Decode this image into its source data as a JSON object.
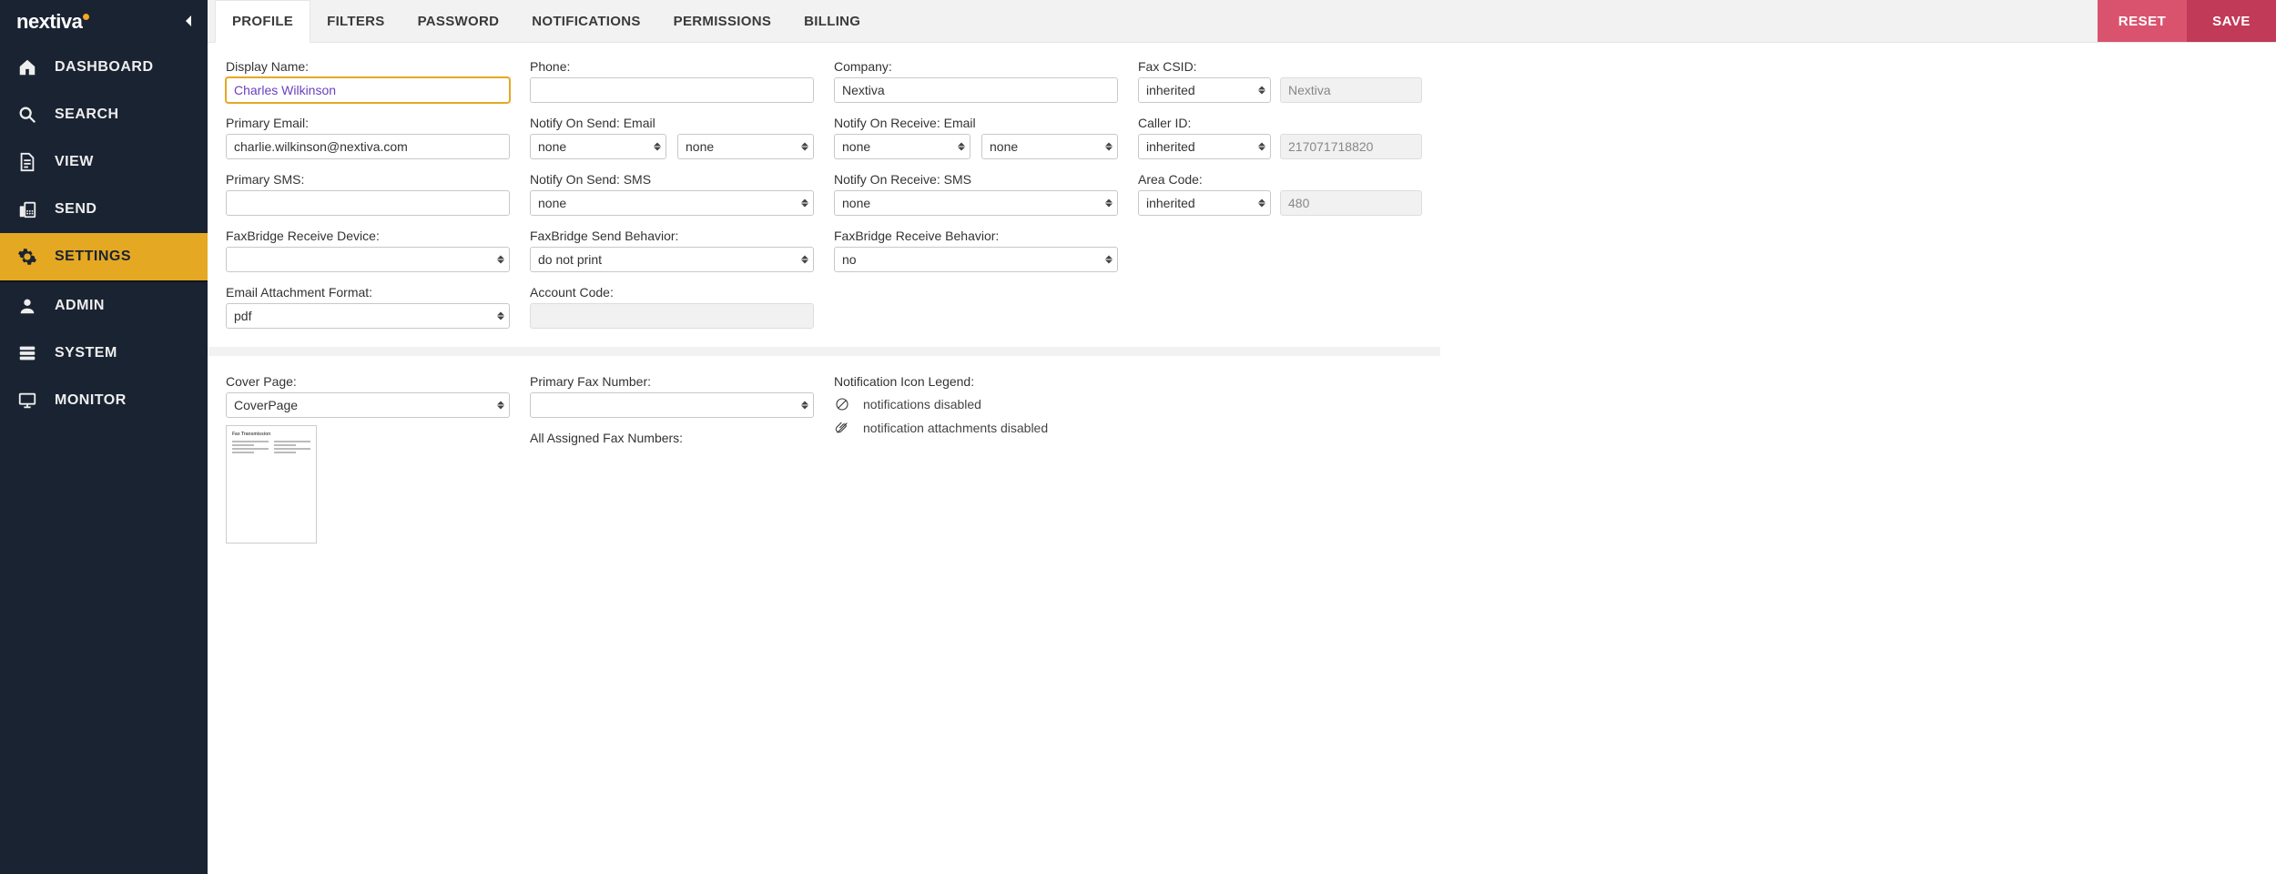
{
  "brand": {
    "name": "nextiva"
  },
  "sidebar": {
    "items": [
      {
        "label": "DASHBOARD",
        "icon": "home-icon",
        "active": false
      },
      {
        "label": "SEARCH",
        "icon": "search-icon",
        "active": false
      },
      {
        "label": "VIEW",
        "icon": "document-icon",
        "active": false
      },
      {
        "label": "SEND",
        "icon": "fax-icon",
        "active": false
      },
      {
        "label": "SETTINGS",
        "icon": "gear-icon",
        "active": true
      },
      {
        "label": "ADMIN",
        "icon": "user-icon",
        "active": false
      },
      {
        "label": "SYSTEM",
        "icon": "server-icon",
        "active": false
      },
      {
        "label": "MONITOR",
        "icon": "monitor-icon",
        "active": false
      }
    ]
  },
  "tabs": [
    {
      "label": "PROFILE",
      "active": true
    },
    {
      "label": "FILTERS",
      "active": false
    },
    {
      "label": "PASSWORD",
      "active": false
    },
    {
      "label": "NOTIFICATIONS",
      "active": false
    },
    {
      "label": "PERMISSIONS",
      "active": false
    },
    {
      "label": "BILLING",
      "active": false
    }
  ],
  "actions": {
    "reset": "RESET",
    "save": "SAVE"
  },
  "form": {
    "display_name": {
      "label": "Display Name:",
      "value": "Charles Wilkinson"
    },
    "phone": {
      "label": "Phone:",
      "value": ""
    },
    "company": {
      "label": "Company:",
      "value": "Nextiva"
    },
    "fax_csid": {
      "label": "Fax CSID:",
      "select": "inherited",
      "readonly": "Nextiva"
    },
    "primary_email": {
      "label": "Primary Email:",
      "value": "charlie.wilkinson@nextiva.com"
    },
    "notify_send_email": {
      "label": "Notify On Send: Email",
      "value_a": "none",
      "value_b": "none"
    },
    "notify_receive_email": {
      "label": "Notify On Receive: Email",
      "value_a": "none",
      "value_b": "none"
    },
    "caller_id": {
      "label": "Caller ID:",
      "select": "inherited",
      "readonly": "217071718820"
    },
    "primary_sms": {
      "label": "Primary SMS:",
      "value": ""
    },
    "notify_send_sms": {
      "label": "Notify On Send: SMS",
      "value": "none"
    },
    "notify_receive_sms": {
      "label": "Notify On Receive: SMS",
      "value": "none"
    },
    "area_code": {
      "label": "Area Code:",
      "select": "inherited",
      "readonly": "480"
    },
    "fb_receive_device": {
      "label": "FaxBridge Receive Device:",
      "value": ""
    },
    "fb_send_behavior": {
      "label": "FaxBridge Send Behavior:",
      "value": "do not print"
    },
    "fb_receive_behavior": {
      "label": "FaxBridge Receive Behavior:",
      "value": "no"
    },
    "email_attachment_format": {
      "label": "Email Attachment Format:",
      "value": "pdf"
    },
    "account_code": {
      "label": "Account Code:",
      "value": ""
    },
    "cover_page": {
      "label": "Cover Page:",
      "value": "CoverPage",
      "thumb_title": "Fax Transmission"
    },
    "primary_fax_number": {
      "label": "Primary Fax Number:",
      "value": ""
    },
    "all_assigned_fax_numbers": {
      "label": "All Assigned Fax Numbers:"
    },
    "legend": {
      "title": "Notification Icon Legend:",
      "disabled": "notifications disabled",
      "attachments_disabled": "notification attachments disabled"
    }
  }
}
